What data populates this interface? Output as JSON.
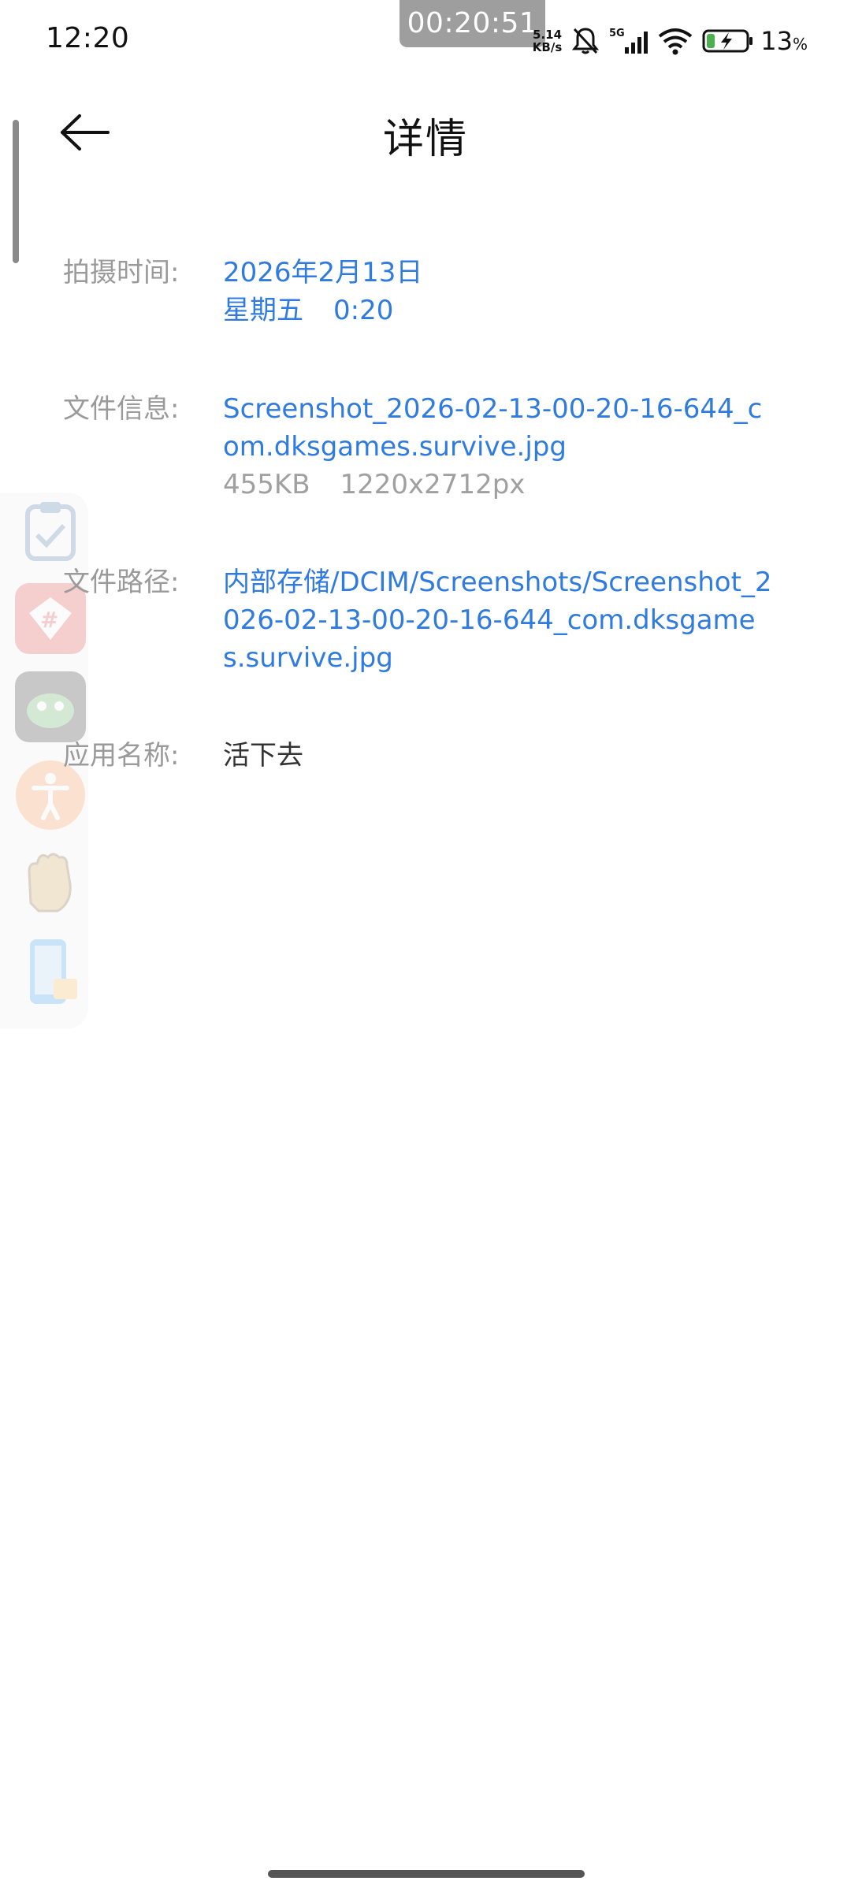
{
  "status_bar": {
    "time": "12:20",
    "recording_timer": "00:20:51",
    "net_speed_value": "5.14",
    "net_speed_unit": "KB/s",
    "network_label": "5G",
    "battery_percent": "13",
    "battery_unit": "%",
    "icons": [
      "bell-mute-icon",
      "signal-5g-icon",
      "wifi-icon",
      "battery-charging-icon"
    ]
  },
  "header": {
    "title": "详情",
    "back_icon": "arrow-left-icon"
  },
  "details": {
    "capture_time": {
      "label": "拍摄时间:",
      "date": "2026年2月13日",
      "weekday": "星期五",
      "time": "0:20"
    },
    "file_info": {
      "label": "文件信息:",
      "filename": "Screenshot_2026-02-13-00-20-16-644_com.dksgames.survive.jpg",
      "size": "455KB",
      "dimensions": "1220x2712px"
    },
    "file_path": {
      "label": "文件路径:",
      "path": "内部存储/DCIM/Screenshots/Screenshot_2026-02-13-00-20-16-644_com.dksgames.survive.jpg"
    },
    "app_name": {
      "label": "应用名称:",
      "value": "活下去"
    }
  },
  "side_dock": {
    "apps": [
      "clipboard-icon",
      "hashtag-app-icon",
      "game-app-icon",
      "accessibility-icon",
      "glove-app-icon",
      "phone-mirror-icon"
    ]
  },
  "colors": {
    "link": "#2f7be0",
    "label": "#9a9a9a",
    "muted": "#a0a0a0"
  }
}
